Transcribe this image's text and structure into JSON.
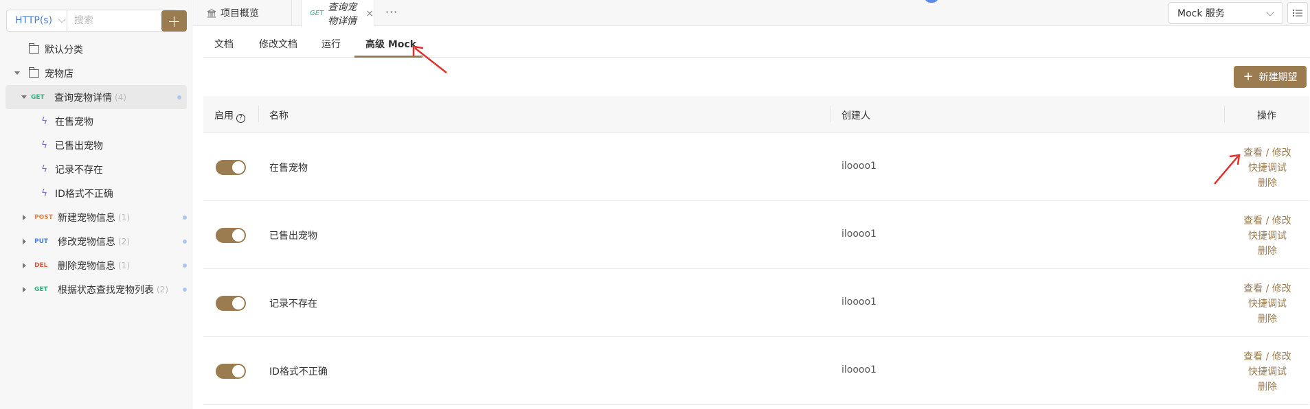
{
  "sidebar": {
    "protocol": "HTTP(s)",
    "search_placeholder": "搜索",
    "add_label": "+",
    "tree": [
      {
        "type": "folder",
        "label": "默认分类"
      },
      {
        "type": "folder",
        "label": "宠物店"
      },
      {
        "type": "api",
        "method": "GET",
        "label": "查询宠物详情",
        "count": "(4)"
      },
      {
        "type": "mock",
        "label": "在售宠物"
      },
      {
        "type": "mock",
        "label": "已售出宠物"
      },
      {
        "type": "mock",
        "label": "记录不存在"
      },
      {
        "type": "mock",
        "label": "ID格式不正确"
      },
      {
        "type": "api",
        "method": "POST",
        "label": "新建宠物信息",
        "count": "(1)"
      },
      {
        "type": "api",
        "method": "PUT",
        "label": "修改宠物信息",
        "count": "(2)"
      },
      {
        "type": "api",
        "method": "DEL",
        "label": "删除宠物信息",
        "count": "(1)"
      },
      {
        "type": "api",
        "method": "GET",
        "label": "根据状态查找宠物列表",
        "count": "(2)"
      }
    ]
  },
  "topbar": {
    "tabs": [
      {
        "label": "项目概览"
      },
      {
        "method": "GET",
        "label": "查询宠物详情"
      }
    ],
    "more": "···",
    "mock_select": "Mock 服务"
  },
  "subtabs": [
    "文档",
    "修改文档",
    "运行",
    "高级 Mock"
  ],
  "new_button": "新建期望",
  "table": {
    "headers": {
      "enabled": "启用",
      "name": "名称",
      "creator": "创建人",
      "actions": "操作"
    },
    "ops": {
      "view": "查看 / 修改",
      "debug": "快捷调试",
      "delete": "删除"
    },
    "rows": [
      {
        "enabled": true,
        "name": "在售宠物",
        "creator": "iloooo1"
      },
      {
        "enabled": true,
        "name": "已售出宠物",
        "creator": "iloooo1"
      },
      {
        "enabled": true,
        "name": "记录不存在",
        "creator": "iloooo1"
      },
      {
        "enabled": true,
        "name": "ID格式不正确",
        "creator": "iloooo1"
      }
    ]
  },
  "colors": {
    "accent": "#9b7b50",
    "get": "#38b27d",
    "post": "#f0803a",
    "put": "#4a82e8",
    "del": "#e8503a",
    "annotation": "#e0302a"
  }
}
